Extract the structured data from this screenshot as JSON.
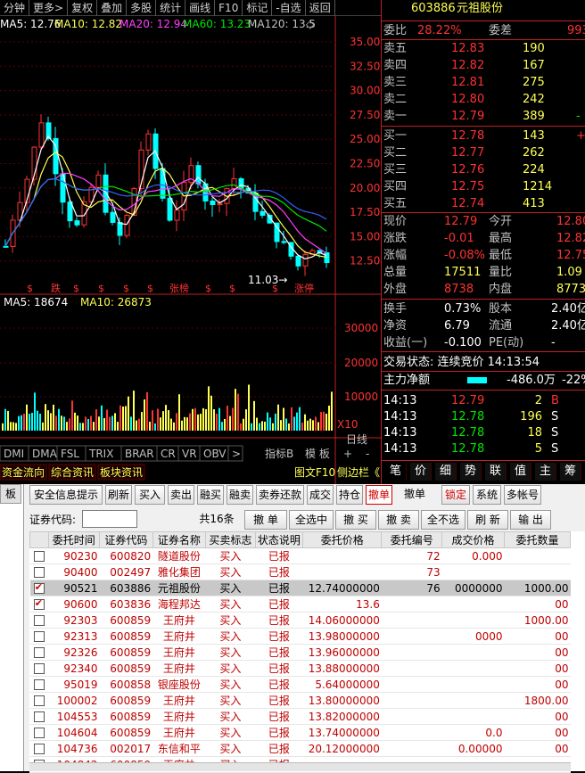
{
  "toolbar": {
    "items": [
      "分钟",
      "更多>",
      "复权",
      "叠加",
      "多股",
      "统计",
      "画线",
      "F10",
      "标记",
      "-自选",
      "返回"
    ]
  },
  "ma_legend": {
    "ma5": "MA5: 12.76",
    "ma10": "MA10: 12.82",
    "ma20": "MA20: 12.94",
    "ma60": "MA60: 13.23",
    "ma120": "MA120: 13.5"
  },
  "price_axis": [
    "35.00",
    "32.50",
    "30.00",
    "27.50",
    "25.00",
    "22.50",
    "20.00",
    "17.50",
    "15.00",
    "12.50"
  ],
  "low_label": "11.03",
  "tags": [
    "$",
    "跌",
    "$",
    "$",
    "$",
    "$",
    "张榜",
    "$",
    "$",
    "$",
    "涨停"
  ],
  "vol_legend": {
    "ma5": "MA5: 18674",
    "ma10": "MA10: 26873"
  },
  "vol_axis": [
    "30000",
    "20000",
    "10000",
    "X10"
  ],
  "indicator_tabs": [
    "DMI",
    "DMA",
    "FSL",
    "TRIX",
    "BRAR",
    "CR",
    "VR",
    "OBV",
    ">"
  ],
  "indicator_extra": {
    "index_b": "指标B",
    "template": "模 板",
    "plus": "+",
    "minus": "-",
    "day": "日线"
  },
  "bottom_tabs": [
    "资金流向",
    "综合资讯",
    "板块资讯"
  ],
  "sidebar_tabs": {
    "f10": "图文F10",
    "side": "侧边栏《",
    "t1": "笔",
    "t2": "价",
    "t3": "细",
    "t4": "势",
    "t5": "联",
    "t6": "值",
    "t7": "主",
    "t8": "筹"
  },
  "quote": {
    "code": "603886",
    "name": "元祖股份",
    "weibi_label": "委比",
    "weibi_val": "28.22%",
    "weicha_label": "委差",
    "weicha_val": "993",
    "asks": [
      {
        "l": "卖五",
        "p": "12.83",
        "v": "190"
      },
      {
        "l": "卖四",
        "p": "12.82",
        "v": "167"
      },
      {
        "l": "卖三",
        "p": "12.81",
        "v": "275"
      },
      {
        "l": "卖二",
        "p": "12.80",
        "v": "242"
      },
      {
        "l": "卖一",
        "p": "12.79",
        "v": "389",
        "e": "-"
      }
    ],
    "bids": [
      {
        "l": "买一",
        "p": "12.78",
        "v": "143",
        "e": "+"
      },
      {
        "l": "买二",
        "p": "12.77",
        "v": "262"
      },
      {
        "l": "买三",
        "p": "12.76",
        "v": "224"
      },
      {
        "l": "买四",
        "p": "12.75",
        "v": "1214"
      },
      {
        "l": "买五",
        "p": "12.74",
        "v": "413"
      }
    ],
    "stats": [
      {
        "l1": "现价",
        "v1": "12.79",
        "l2": "今开",
        "v2": "12.80"
      },
      {
        "l1": "涨跌",
        "v1": "-0.01",
        "l2": "最高",
        "v2": "12.82"
      },
      {
        "l1": "涨幅",
        "v1": "-0.08%",
        "l2": "最低",
        "v2": "12.75"
      },
      {
        "l1": "总量",
        "v1": "17511",
        "l2": "量比",
        "v2": "1.09"
      },
      {
        "l1": "外盘",
        "v1": "8738",
        "l2": "内盘",
        "v2": "8773"
      }
    ],
    "fund": [
      {
        "l1": "换手",
        "v1": "0.73%",
        "l2": "股本",
        "v2": "2.40亿"
      },
      {
        "l1": "净资",
        "v1": "6.79",
        "l2": "流通",
        "v2": "2.40亿"
      },
      {
        "l1": "收益(一)",
        "v1": "-0.100",
        "l2": "PE(动)",
        "v2": "-"
      }
    ],
    "status": "交易状态: 连续竞价 14:13:54",
    "net_label": "主力净额",
    "net_val": "-486.0万",
    "net_pct": "-22%",
    "ticks": [
      {
        "t": "14:13",
        "p": "12.79",
        "v": "2",
        "s": "B"
      },
      {
        "t": "14:13",
        "p": "12.78",
        "v": "196",
        "s": "S"
      },
      {
        "t": "14:13",
        "p": "12.78",
        "v": "18",
        "s": "S"
      },
      {
        "t": "14:13",
        "p": "12.78",
        "v": "5",
        "s": "S"
      }
    ]
  },
  "trade_panel": {
    "left_label": "板",
    "actions": [
      "安全信息提示",
      "刷新",
      "买入",
      "卖出",
      "融买",
      "融卖",
      "卖券还款",
      "成交",
      "持仓",
      "撤单",
      "撤单",
      "锁定",
      "系统",
      "多帐号"
    ],
    "code_label": "证券代码:",
    "code_value": "",
    "count": "共16条",
    "ops": [
      "撤 单",
      "全选中",
      "撤 买",
      "撤 卖",
      "全不选",
      "刷 新",
      "输 出"
    ],
    "headers": [
      "委托时间",
      "证券代码",
      "证券名称",
      "买卖标志",
      "状态说明",
      "委托价格",
      "委托编号",
      "成交价格",
      "委托数量"
    ],
    "rows": [
      {
        "chk": false,
        "time": "90230",
        "code": "600820",
        "name": "隧道股份",
        "dir": "买入",
        "st": "已报",
        "price": "",
        "no": "72",
        "dp": "0.000",
        "qty": ""
      },
      {
        "chk": false,
        "time": "90400",
        "code": "002497",
        "name": "雅化集团",
        "dir": "买入",
        "st": "已报",
        "price": "",
        "no": "73",
        "dp": "",
        "qty": ""
      },
      {
        "chk": true,
        "time": "90521",
        "code": "603886",
        "name": "元祖股份",
        "dir": "买入",
        "st": "已报",
        "price": "12.74000000",
        "no": "76",
        "dp": "0000000",
        "qty": "1000.00"
      },
      {
        "chk": true,
        "time": "90600",
        "code": "603836",
        "name": "海程邦达",
        "dir": "买入",
        "st": "已报",
        "price": "13.6",
        "no": "",
        "dp": "",
        "qty": "00"
      },
      {
        "chk": false,
        "time": "92303",
        "code": "600859",
        "name": "王府井",
        "dir": "买入",
        "st": "已报",
        "price": "14.06000000",
        "no": "",
        "dp": "",
        "qty": "1000.00"
      },
      {
        "chk": false,
        "time": "92313",
        "code": "600859",
        "name": "王府井",
        "dir": "买入",
        "st": "已报",
        "price": "13.98000000",
        "no": "",
        "dp": "0000",
        "qty": "00"
      },
      {
        "chk": false,
        "time": "92326",
        "code": "600859",
        "name": "王府井",
        "dir": "买入",
        "st": "已报",
        "price": "13.96000000",
        "no": "",
        "dp": "",
        "qty": "00"
      },
      {
        "chk": false,
        "time": "92340",
        "code": "600859",
        "name": "王府井",
        "dir": "买入",
        "st": "已报",
        "price": "13.88000000",
        "no": "",
        "dp": "",
        "qty": "00"
      },
      {
        "chk": false,
        "time": "95019",
        "code": "600858",
        "name": "银座股份",
        "dir": "买入",
        "st": "已报",
        "price": "5.64000000",
        "no": "",
        "dp": "",
        "qty": "00"
      },
      {
        "chk": false,
        "time": "100002",
        "code": "600859",
        "name": "王府井",
        "dir": "买入",
        "st": "已报",
        "price": "13.80000000",
        "no": "",
        "dp": "",
        "qty": "1800.00"
      },
      {
        "chk": false,
        "time": "104553",
        "code": "600859",
        "name": "王府井",
        "dir": "买入",
        "st": "已报",
        "price": "13.82000000",
        "no": "",
        "dp": "",
        "qty": "00"
      },
      {
        "chk": false,
        "time": "104604",
        "code": "600859",
        "name": "王府井",
        "dir": "买入",
        "st": "已报",
        "price": "13.74000000",
        "no": "",
        "dp": "0.0",
        "qty": "00"
      },
      {
        "chk": false,
        "time": "104736",
        "code": "002017",
        "name": "东信和平",
        "dir": "买入",
        "st": "已报",
        "price": "20.12000000",
        "no": "",
        "dp": "0.00000",
        "qty": "00"
      },
      {
        "chk": false,
        "time": "104842",
        "code": "600859",
        "name": "王府井",
        "dir": "买入",
        "st": "已报",
        "price": "",
        "no": "",
        "dp": "",
        "qty": ""
      }
    ]
  },
  "colors": {
    "red": "#ff3232",
    "green": "#00e600",
    "yellow": "#ffff54",
    "cyan": "#00ffff",
    "dark_red": "#c02020"
  }
}
